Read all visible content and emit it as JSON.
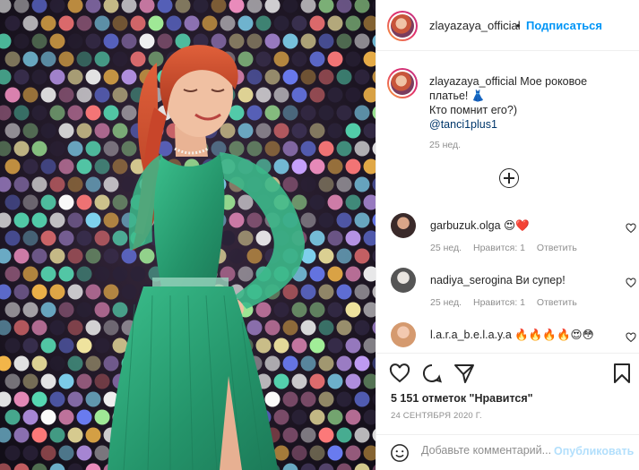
{
  "post": {
    "author": "zlayazaya_official",
    "follow_separator": "•",
    "follow_label": "Подписаться",
    "caption_line1": "Мое роковое платье! 👗",
    "caption_line2": "Кто помнит его?)",
    "caption_mention": "@tanci1plus1",
    "caption_time": "25 нед."
  },
  "comments": [
    {
      "user": "garbuzuk.olga",
      "text": "😍❤️",
      "time": "25 нед.",
      "likes": "Нравится: 1",
      "reply": "Ответить"
    },
    {
      "user": "nadiya_serogina",
      "text": "Ви супер!",
      "time": "25 нед.",
      "likes": "Нравится: 1",
      "reply": "Ответить"
    },
    {
      "user": "l.a.r.a_b.e.l.a.y.a",
      "text": "🔥🔥🔥🔥😍😳"
    }
  ],
  "footer": {
    "likes_text": "5 151 отметок \"Нравится\"",
    "date_text": "24 СЕНТЯБРЯ 2020 Г.",
    "comment_placeholder": "Добавьте комментарий...",
    "publish_label": "Опубликовать"
  },
  "colors": {
    "link": "#0095f6",
    "mention": "#00376b",
    "muted": "#8e8e8e",
    "dress": "#2fa87a",
    "hair": "#c8452a"
  },
  "icons": [
    "heart-icon",
    "comment-icon",
    "share-icon",
    "bookmark-icon",
    "emoji-icon",
    "plus-circle-icon"
  ]
}
